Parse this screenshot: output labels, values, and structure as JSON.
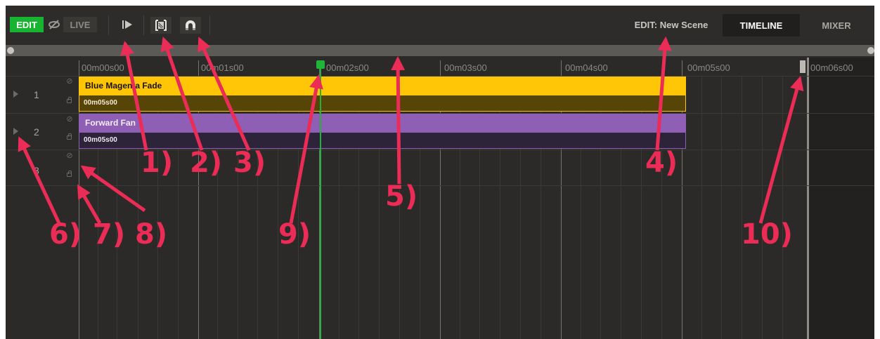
{
  "toolbar": {
    "edit_label": "EDIT",
    "live_label": "LIVE",
    "scene_label": "EDIT: New Scene",
    "tabs": [
      {
        "label": "TIMELINE",
        "active": true
      },
      {
        "label": "MIXER",
        "active": false
      }
    ]
  },
  "ruler": {
    "ticks": [
      "00m00s00",
      "00m01s00",
      "00m02s00",
      "00m03s00",
      "00m04s00",
      "00m05s00",
      "00m06s00"
    ]
  },
  "tracks": [
    {
      "number": "1",
      "clip": {
        "name": "Blue Magenta Fade",
        "duration": "00m05s00",
        "color": "#ffc607",
        "body_color": "#574507"
      }
    },
    {
      "number": "2",
      "clip": {
        "name": "Forward Fan",
        "duration": "00m05s00",
        "color": "#8e5fb5",
        "body_color": "#2e2439"
      }
    },
    {
      "number": "3"
    }
  ],
  "annotations": [
    "1)",
    "2)",
    "3)",
    "4)",
    "5)",
    "6)",
    "7)",
    "8)",
    "9)",
    "10)"
  ],
  "colors": {
    "accent_green": "#1eb53a",
    "annotation_red": "#ea2c56",
    "background": "#2c2a28"
  }
}
